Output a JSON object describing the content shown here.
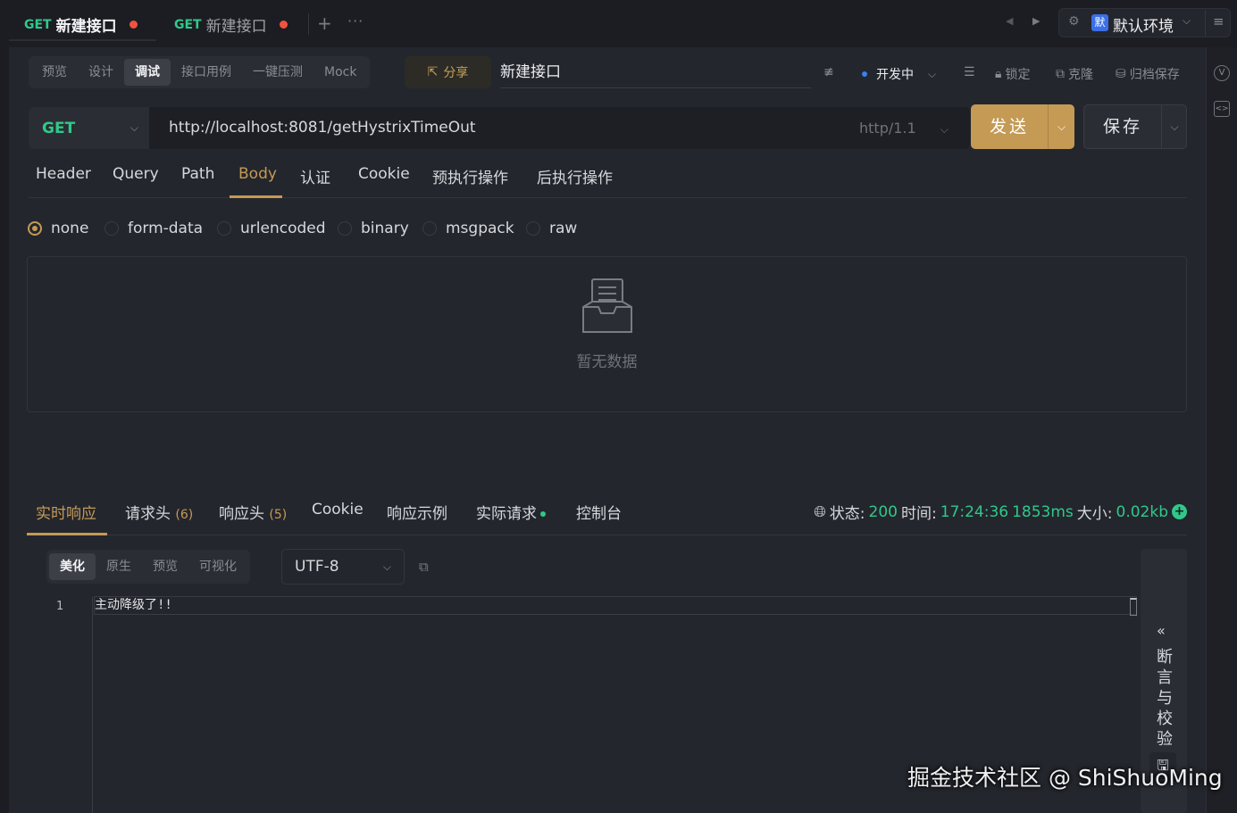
{
  "tabs": [
    {
      "method": "GET",
      "title": "新建接口"
    },
    {
      "method": "GET",
      "title": "新建接口"
    }
  ],
  "env": {
    "badge": "默",
    "label": "默认环境"
  },
  "mode_tabs": [
    "预览",
    "设计",
    "调试",
    "接口用例",
    "一键压测",
    "Mock"
  ],
  "share_label": "分享",
  "api_name": "新建接口",
  "toolbar": {
    "status": "开发中",
    "lock": "锁定",
    "clone": "克隆",
    "archive": "归档保存"
  },
  "request": {
    "method": "GET",
    "url": "http://localhost:8081/getHystrixTimeOut",
    "protocol": "http/1.1",
    "send_label": "发送",
    "save_label": "保存"
  },
  "req_tabs": [
    "Header",
    "Query",
    "Path",
    "Body",
    "认证",
    "Cookie",
    "预执行操作",
    "后执行操作"
  ],
  "body_types": [
    "none",
    "form-data",
    "urlencoded",
    "binary",
    "msgpack",
    "raw"
  ],
  "body_empty_text": "暂无数据",
  "response": {
    "tabs": {
      "realtime": "实时响应",
      "req_headers": "请求头",
      "req_headers_count": "(6)",
      "resp_headers": "响应头",
      "resp_headers_count": "(5)",
      "cookie": "Cookie",
      "example": "响应示例",
      "actual": "实际请求",
      "console": "控制台"
    },
    "status_label": "状态:",
    "status_value": "200",
    "time_label": "时间:",
    "time_value": "17:24:36",
    "duration": "1853ms",
    "size_label": "大小:",
    "size_value": "0.02kb",
    "format_tabs": [
      "美化",
      "原生",
      "预览",
      "可视化"
    ],
    "encoding": "UTF-8",
    "line_number": "1",
    "body": "主动降级了!!",
    "side_panel": "断言与校验"
  },
  "watermark": "掘金技术社区 @ ShiShuoMing",
  "colors": {
    "accent": "#c49a55",
    "get": "#2fc98a",
    "dirty_dot": "#f0533f"
  }
}
